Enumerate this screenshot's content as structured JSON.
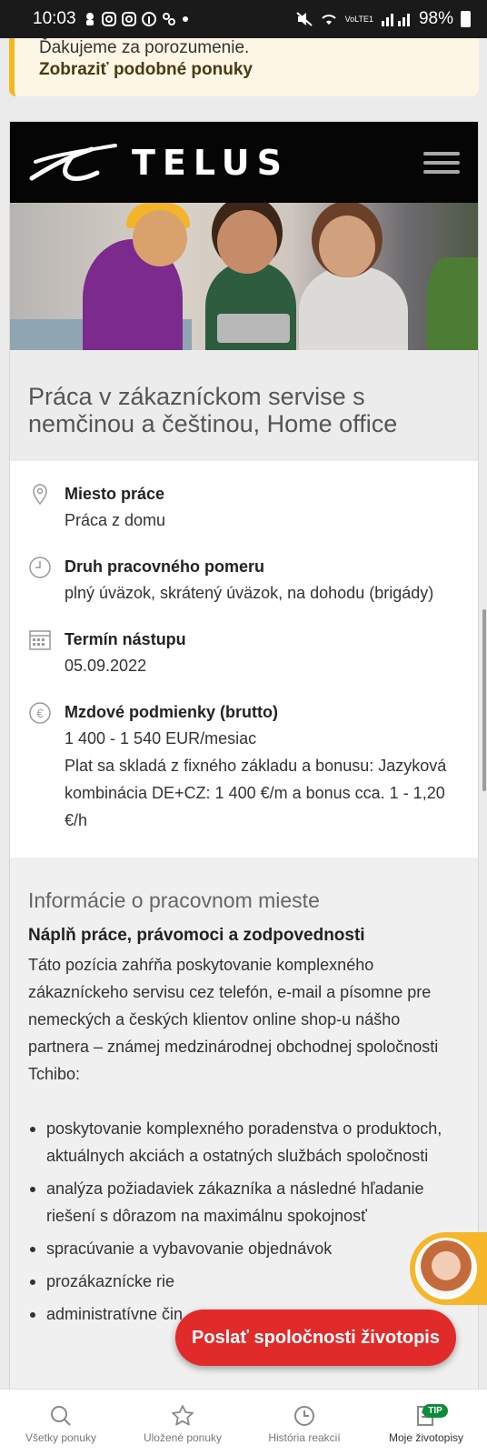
{
  "statusbar": {
    "time": "10:03",
    "network": "VoLTE1",
    "battery": "98%",
    "icons": [
      "notification-icon",
      "instagram-icon",
      "instagram-icon",
      "facebook-icon",
      "fan-icon",
      "dot-icon"
    ]
  },
  "notice": {
    "text": "Ďakujeme za porozumenie.",
    "link": "Zobraziť podobné ponuky"
  },
  "header": {
    "logo_text": "TELUS"
  },
  "job": {
    "title": "Práca v zákazníckom servise s nemčinou a češtinou, Home office"
  },
  "details": [
    {
      "icon": "location-pin-icon",
      "label": "Miesto práce",
      "value": "Práca z domu"
    },
    {
      "icon": "clock-icon",
      "label": "Druh pracovného pomeru",
      "value": "plný úväzok, skrátený úväzok, na dohodu (brigády)"
    },
    {
      "icon": "calendar-icon",
      "label": "Termín nástupu",
      "value": "05.09.2022"
    },
    {
      "icon": "euro-icon",
      "label": "Mzdové podmienky (brutto)",
      "value": "1 400 - 1 540 EUR/mesiac",
      "note": "Plat sa skladá z fixného základu a bonusu: Jazyková kombinácia DE+CZ: 1 400 €/m a bonus cca. 1 - 1,20 €/h"
    }
  ],
  "info": {
    "title": "Informácie o pracovnom mieste",
    "subtitle": "Náplň práce, právomoci a zodpovednosti",
    "paragraph": "Táto pozícia zahŕňa poskytovanie komplexného zákazníckeho servisu cez telefón, e-mail a písomne pre nemeckých a českých klientov online shop-u nášho partnera – známej medzinárodnej obchodnej spoločnosti Tchibo:",
    "bullets": [
      "poskytovanie komplexného poradenstva o produktoch, aktuálnych akciách a ostatných službách spoločnosti",
      "analýza požiadaviek zákazníka a následné hľadanie riešení s dôrazom na maximálnu spokojnosť",
      "spracúvanie a vybavovanie objednávok",
      "prozákaznícke rie",
      "administratívne čin"
    ]
  },
  "cta": {
    "label": "Poslať spoločnosti životopis"
  },
  "bottomnav": {
    "items": [
      {
        "icon": "search-icon",
        "label": "Všetky ponuky"
      },
      {
        "icon": "star-icon",
        "label": "Uložené ponuky"
      },
      {
        "icon": "clock-icon",
        "label": "História reakcií"
      },
      {
        "icon": "cv-icon",
        "label": "Moje životopisy",
        "badge": "TIP"
      }
    ]
  },
  "colors": {
    "accent_red": "#e02b2a",
    "notice_yellow": "#f3b81b",
    "tip_green": "#0e8c3c",
    "header_black": "#050505"
  }
}
